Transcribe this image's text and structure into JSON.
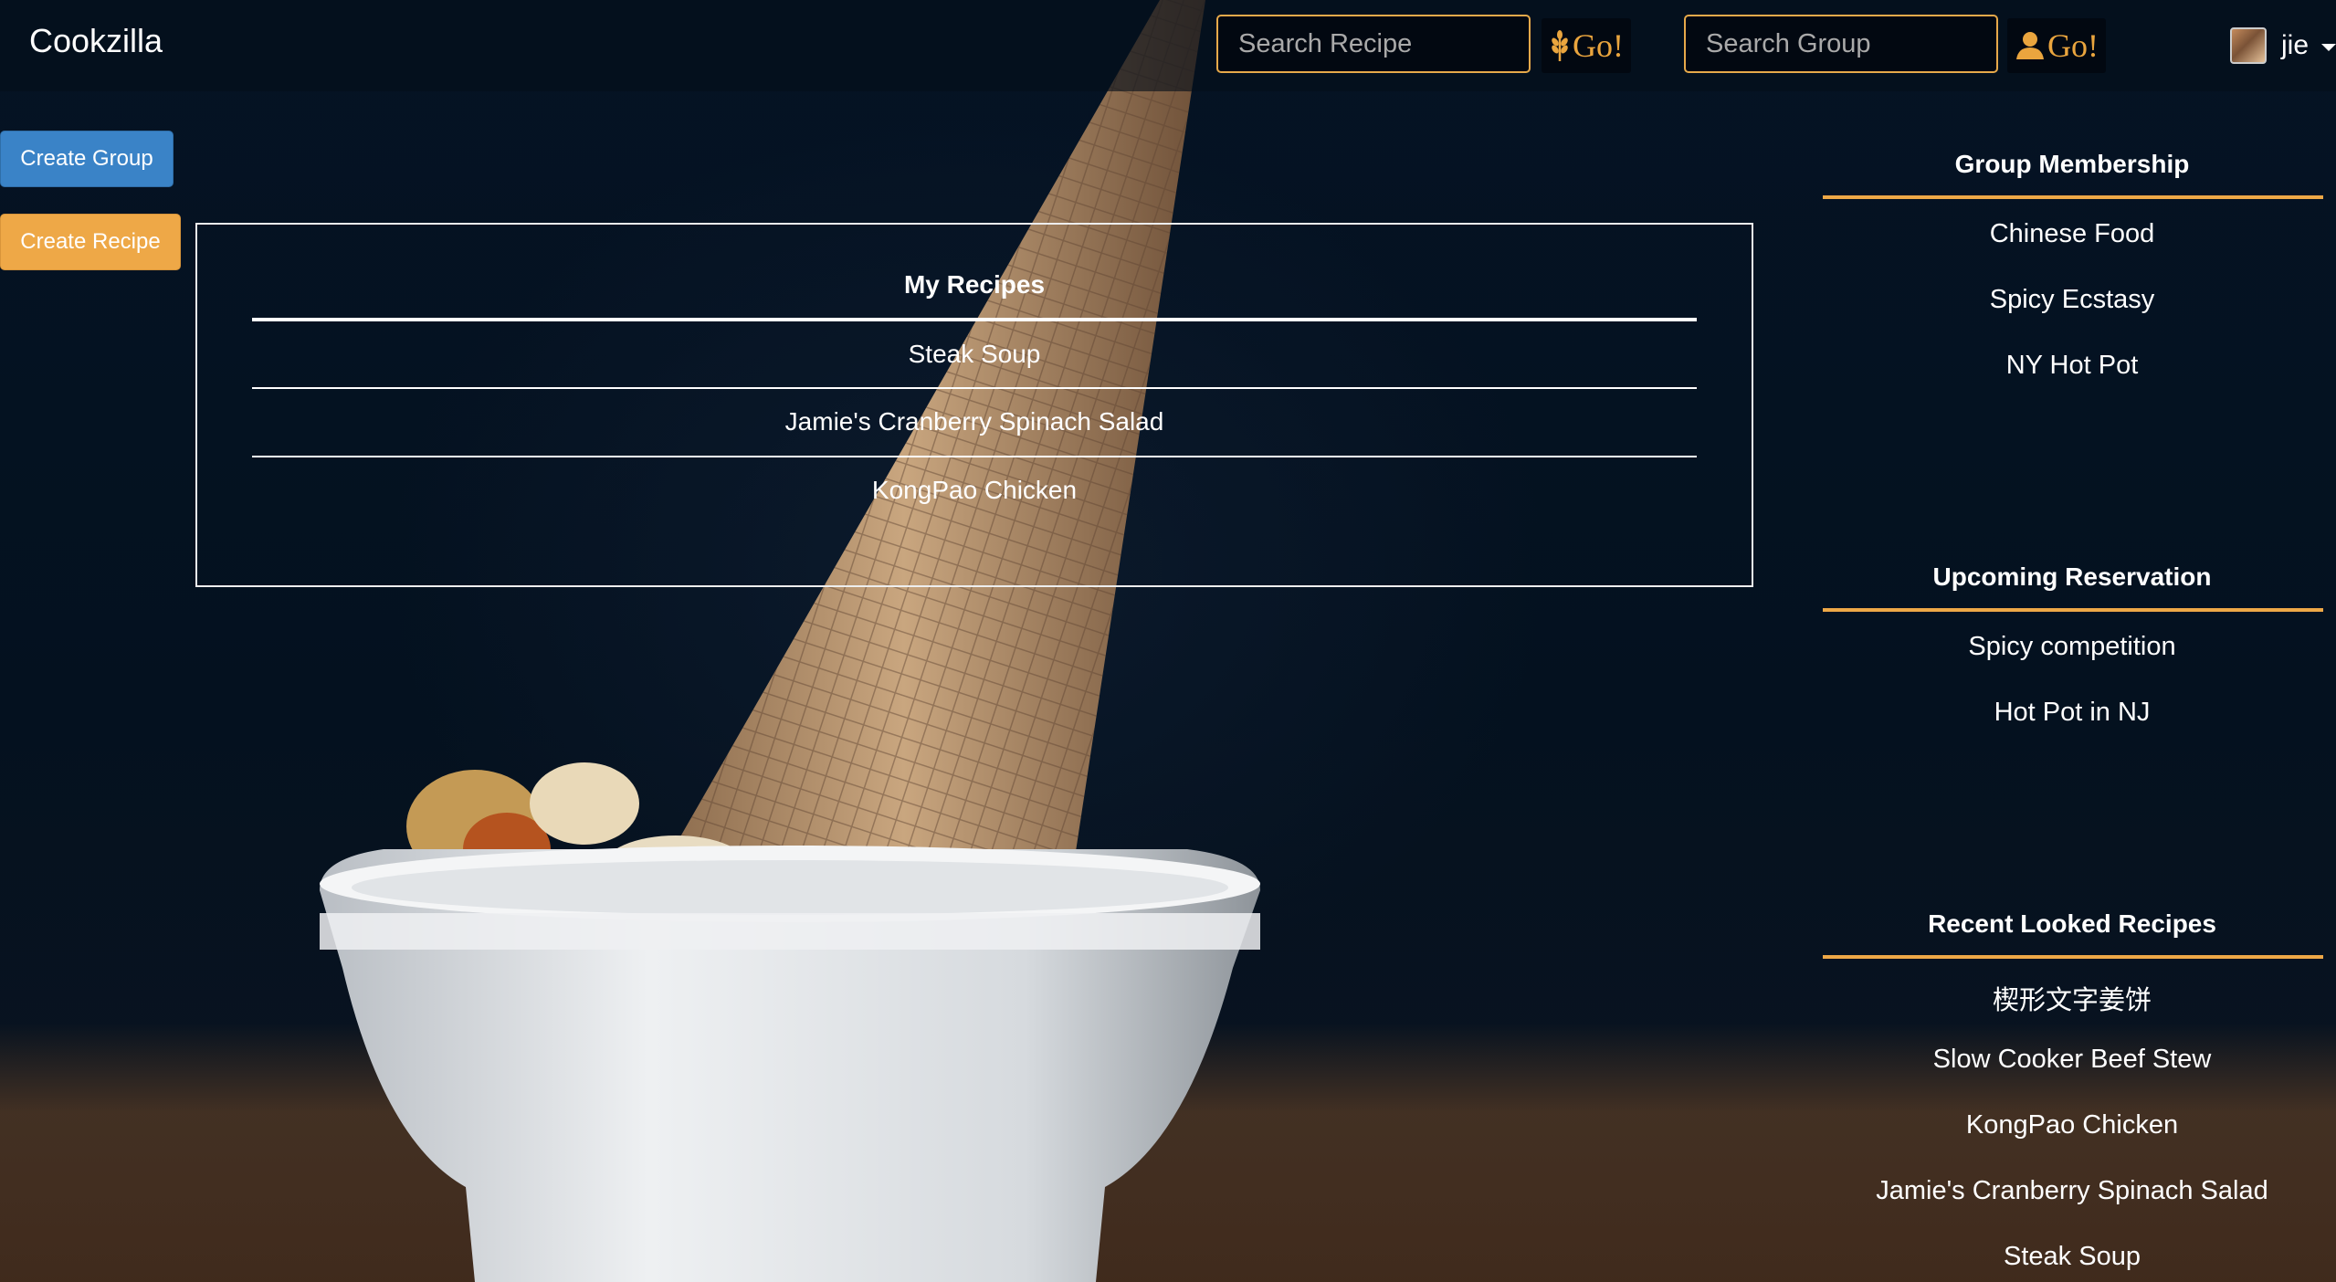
{
  "navbar": {
    "brand": "Cookzilla",
    "recipe_search": {
      "placeholder": "Search Recipe",
      "go_label": "Go!",
      "icon": "wheat-icon"
    },
    "group_search": {
      "placeholder": "Search Group",
      "go_label": "Go!",
      "icon": "person-icon"
    },
    "user": {
      "name": "jie"
    }
  },
  "actions": {
    "create_group": "Create Group",
    "create_recipe": "Create Recipe"
  },
  "my_recipes": {
    "title": "My Recipes",
    "items": [
      "Steak Soup",
      "Jamie's Cranberry Spinach Salad",
      "KongPao Chicken"
    ]
  },
  "sidebar": {
    "group_membership": {
      "title": "Group Membership",
      "items": [
        "Chinese Food",
        "Spicy Ecstasy",
        "NY Hot Pot"
      ]
    },
    "upcoming_reservation": {
      "title": "Upcoming Reservation",
      "items": [
        "Spicy competition",
        "Hot Pot in NJ"
      ]
    },
    "recent_recipes": {
      "title": "Recent Looked Recipes",
      "items": [
        "楔形文字姜饼",
        "Slow Cooker Beef Stew",
        "KongPao Chicken",
        "Jamie's Cranberry Spinach Salad",
        "Steak Soup"
      ]
    }
  },
  "colors": {
    "accent_orange": "#eea847",
    "button_blue": "#3a83c7",
    "background_navy": "#051324"
  }
}
